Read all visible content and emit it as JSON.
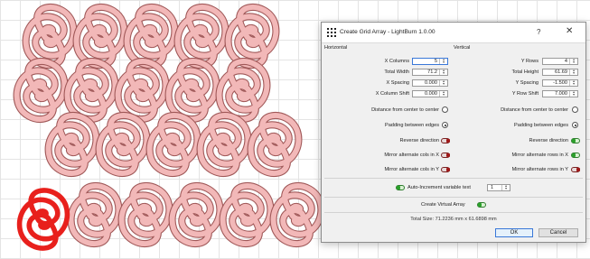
{
  "dialog": {
    "title": "Create Grid Array - LightBurn 1.0.00",
    "help": "?",
    "close": "✕",
    "horizontal": {
      "section": "Horizontal",
      "x_columns": {
        "label": "X Columns",
        "value": "5"
      },
      "total_width": {
        "label": "Total Width",
        "value": "71.2"
      },
      "x_spacing": {
        "label": "X Spacing",
        "value": "0.000"
      },
      "x_column_shift": {
        "label": "X Column Shift",
        "value": "0.000"
      },
      "distance_center": {
        "label": "Distance from center to center",
        "checked": false
      },
      "padding_edges": {
        "label": "Padding between edges",
        "checked": true
      },
      "reverse": {
        "label": "Reverse direction",
        "on": false
      },
      "mirror_rows": {
        "label": "Mirror alternate cols in X",
        "on": false
      },
      "mirror_cols": {
        "label": "Mirror alternate cols in Y",
        "on": false
      }
    },
    "vertical": {
      "section": "Vertical",
      "y_rows": {
        "label": "Y Rows",
        "value": "4"
      },
      "total_height": {
        "label": "Total Height",
        "value": "61.69"
      },
      "y_spacing": {
        "label": "Y Spacing",
        "value": "-1.500"
      },
      "y_row_shift": {
        "label": "Y Row Shift",
        "value": "7.000"
      },
      "distance_center": {
        "label": "Distance from center to center",
        "checked": false
      },
      "padding_edges": {
        "label": "Padding between edges",
        "checked": true
      },
      "reverse": {
        "label": "Reverse direction",
        "on": true
      },
      "mirror_rows": {
        "label": "Mirror alternate rows in X",
        "on": true
      },
      "mirror_cols": {
        "label": "Mirror alternate rows in Y",
        "on": false
      }
    },
    "auto_increment": {
      "label": "Auto-Increment variable text",
      "on": true,
      "value": "1"
    },
    "virtual_array": {
      "label": "Create Virtual Array",
      "on": true
    },
    "total_size": "Total Size: 71.2236 mm x 61.6898 mm",
    "ok": "OK",
    "cancel": "Cancel"
  },
  "colors": {
    "shape_fill": "#f2b8b8",
    "shape_stroke": "#a05858",
    "selected_stroke": "#e8201c",
    "grid": "#e4e4e4",
    "toggle_on": "#2aa02a",
    "toggle_off": "#a01818"
  }
}
